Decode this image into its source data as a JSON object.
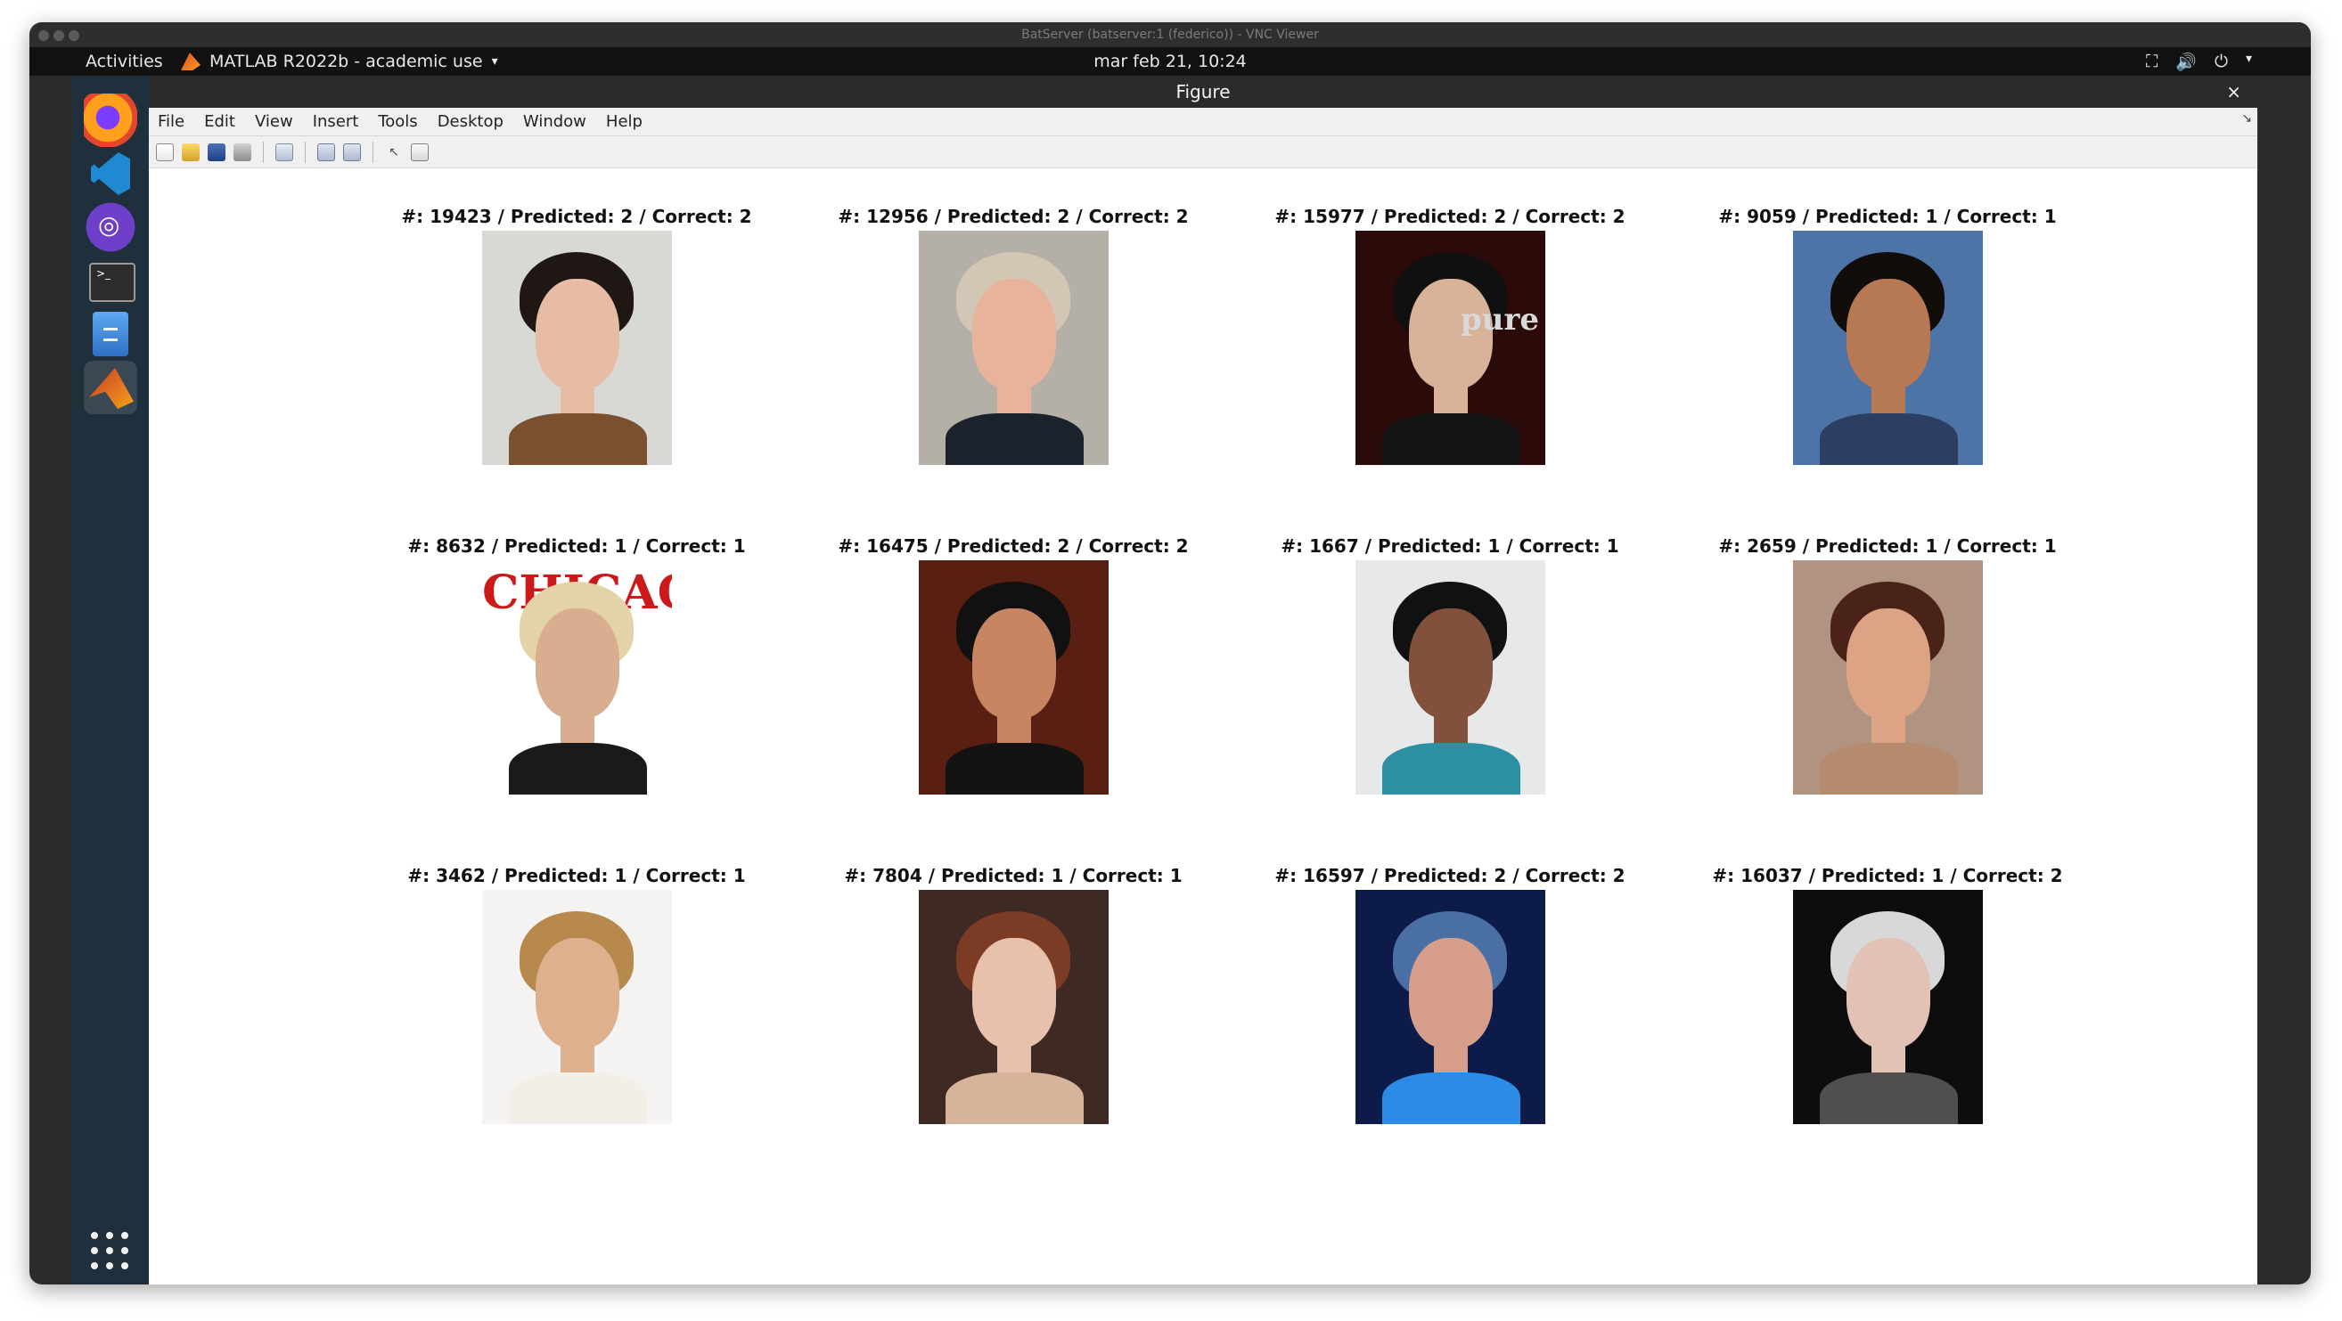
{
  "window": {
    "vnc_title": "BatServer (batserver:1 (federico)) - VNC Viewer",
    "activities": "Activities",
    "app_menu": "MATLAB R2022b - academic use",
    "clock": "mar feb 21, 10:24",
    "tray": {
      "network": "network-icon",
      "volume": "volume-icon",
      "power": "power-icon"
    }
  },
  "figure": {
    "title": "Figure",
    "menu": [
      "File",
      "Edit",
      "View",
      "Insert",
      "Tools",
      "Desktop",
      "Window",
      "Help"
    ],
    "toolbar": [
      "new-figure-icon",
      "open-icon",
      "save-icon",
      "print-icon",
      "link-plot-icon",
      "insert-colorbar-icon",
      "insert-legend-icon",
      "edit-plot-icon",
      "open-property-inspector-icon"
    ]
  },
  "subplots": [
    {
      "label": "#: 19423 / Predicted: 2 / Correct: 2",
      "bg": "#d8d8d5",
      "skin": "#e6bda4",
      "hair": "#1f1713",
      "shirt": "#7a5130"
    },
    {
      "label": "#: 12956 / Predicted: 2 / Correct: 2",
      "bg": "#b4b0a8",
      "skin": "#e8b39a",
      "hair": "#d2c7b4",
      "shirt": "#1c222b"
    },
    {
      "label": "#: 15977 / Predicted: 2 / Correct: 2",
      "bg": "#2b0b0a",
      "skin": "#d8b39a",
      "hair": "#101010",
      "shirt": "#141414",
      "sign_text": "pure"
    },
    {
      "label": "#: 9059 / Predicted: 1 / Correct: 1",
      "bg": "#4e73a6",
      "skin": "#b67954",
      "hair": "#120d0b",
      "shirt": "#2c3f63"
    },
    {
      "label": "#: 8632 / Predicted: 1 / Correct: 1",
      "bg": "#ffffff",
      "skin": "#d9ad8f",
      "hair": "#e4d2a9",
      "shirt": "#1a1a1a",
      "sign_text": "CHICAG"
    },
    {
      "label": "#: 16475 / Predicted: 2 / Correct: 2",
      "bg": "#5a1f13",
      "skin": "#c78561",
      "hair": "#111111",
      "shirt": "#131313"
    },
    {
      "label": "#: 1667 / Predicted: 1 / Correct: 1",
      "bg": "#e6e8ea",
      "skin": "#82513b",
      "hair": "#111111",
      "shirt": "#2c8fa2"
    },
    {
      "label": "#: 2659 / Predicted: 1 / Correct: 1",
      "bg": "#b19381",
      "skin": "#dca484",
      "hair": "#4a2318",
      "shirt": "#b58a6d"
    },
    {
      "label": "#: 3462 / Predicted: 1 / Correct: 1",
      "bg": "#f5f3f1",
      "skin": "#ddb08e",
      "hair": "#b8894c",
      "shirt": "#f3efe8"
    },
    {
      "label": "#: 7804 / Predicted: 1 / Correct: 1",
      "bg": "#3e2a23",
      "skin": "#e7c1ab",
      "hair": "#7b3b25",
      "shirt": "#d8b39c"
    },
    {
      "label": "#: 16597 / Predicted: 2 / Correct: 2",
      "bg": "#0d1b48",
      "skin": "#d89e8c",
      "hair": "#4a6fa4",
      "shirt": "#2d8be8"
    },
    {
      "label": "#: 16037 / Predicted: 1 / Correct: 2",
      "bg": "#0d0d0d",
      "skin": "#e2c2b4",
      "hair": "#d8d8d8",
      "shirt": "#4f4f4f"
    }
  ]
}
